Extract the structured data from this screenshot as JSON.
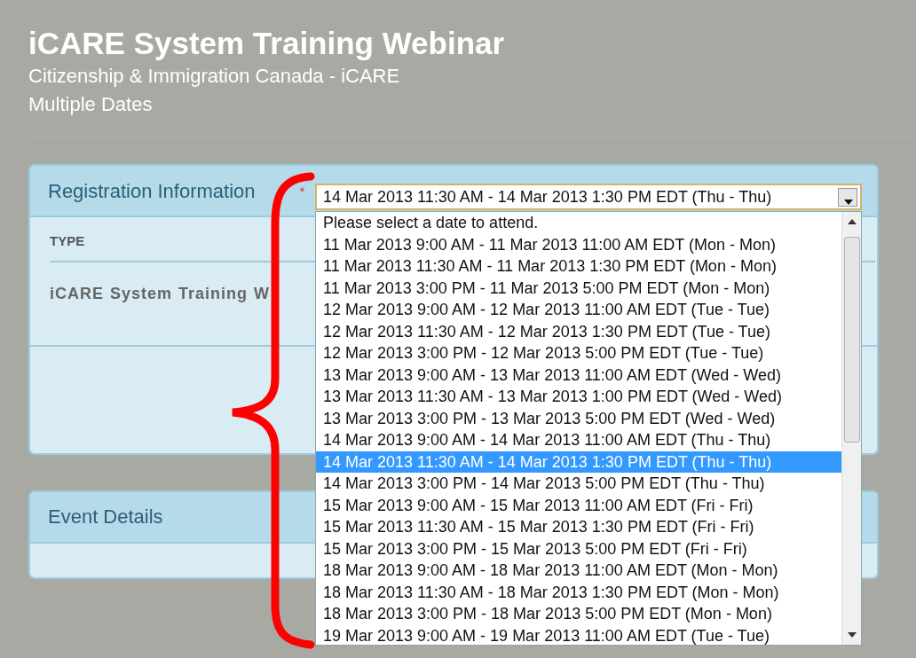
{
  "header": {
    "title": "iCARE System Training Webinar",
    "organization": "Citizenship & Immigration Canada - iCARE",
    "dates": "Multiple Dates"
  },
  "registration": {
    "title": "Registration Information",
    "required_mark": "*",
    "table": {
      "columns": [
        "TYPE"
      ],
      "rows": [
        [
          "iCARE System Training W"
        ]
      ]
    },
    "date_select": {
      "value": "14 Mar 2013 11:30 AM - 14 Mar 2013 1:30 PM EDT (Thu - Thu)",
      "options": [
        {
          "label": "Please select a date to attend.",
          "selected": false
        },
        {
          "label": "11 Mar 2013 9:00 AM - 11 Mar 2013 11:00 AM EDT (Mon - Mon)",
          "selected": false
        },
        {
          "label": "11 Mar 2013 11:30 AM - 11 Mar 2013 1:30 PM EDT (Mon - Mon)",
          "selected": false
        },
        {
          "label": "11 Mar 2013 3:00 PM - 11 Mar 2013 5:00 PM EDT (Mon - Mon)",
          "selected": false
        },
        {
          "label": "12 Mar 2013 9:00 AM - 12 Mar 2013 11:00 AM EDT (Tue - Tue)",
          "selected": false
        },
        {
          "label": "12 Mar 2013 11:30 AM - 12 Mar 2013 1:30 PM EDT (Tue - Tue)",
          "selected": false
        },
        {
          "label": "12 Mar 2013 3:00 PM - 12 Mar 2013 5:00 PM EDT (Tue - Tue)",
          "selected": false
        },
        {
          "label": "13 Mar 2013 9:00 AM - 13 Mar 2013 11:00 AM EDT (Wed - Wed)",
          "selected": false
        },
        {
          "label": "13 Mar 2013 11:30 AM - 13 Mar 2013 1:00 PM EDT (Wed - Wed)",
          "selected": false
        },
        {
          "label": "13 Mar 2013 3:00 PM - 13 Mar 2013 5:00 PM EDT (Wed - Wed)",
          "selected": false
        },
        {
          "label": "14 Mar 2013 9:00 AM - 14 Mar 2013 11:00 AM EDT (Thu - Thu)",
          "selected": false
        },
        {
          "label": "14 Mar 2013 11:30 AM - 14 Mar 2013 1:30 PM EDT (Thu - Thu)",
          "selected": true
        },
        {
          "label": "14 Mar 2013 3:00 PM - 14 Mar 2013 5:00 PM EDT (Thu - Thu)",
          "selected": false
        },
        {
          "label": "15 Mar 2013 9:00 AM - 15 Mar 2013 11:00 AM EDT (Fri - Fri)",
          "selected": false
        },
        {
          "label": "15 Mar 2013 11:30 AM - 15 Mar 2013 1:30 PM EDT (Fri - Fri)",
          "selected": false
        },
        {
          "label": "15 Mar 2013 3:00 PM - 15 Mar 2013 5:00 PM EDT (Fri - Fri)",
          "selected": false
        },
        {
          "label": "18 Mar 2013 9:00 AM - 18 Mar 2013 11:00 AM EDT (Mon - Mon)",
          "selected": false
        },
        {
          "label": "18 Mar 2013 11:30 AM - 18 Mar 2013 1:30 PM EDT (Mon - Mon)",
          "selected": false
        },
        {
          "label": "18 Mar 2013 3:00 PM - 18 Mar 2013 5:00 PM EDT (Mon - Mon)",
          "selected": false
        },
        {
          "label": "19 Mar 2013 9:00 AM - 19 Mar 2013 11:00 AM EDT (Tue - Tue)",
          "selected": false
        }
      ]
    }
  },
  "event_details": {
    "title": "Event Details"
  }
}
